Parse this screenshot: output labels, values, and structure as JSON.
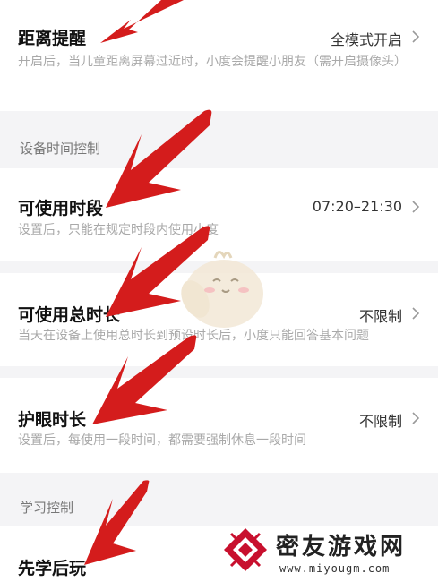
{
  "settings": {
    "distance_reminder": {
      "title": "距离提醒",
      "value": "全模式开启",
      "description": "开启后，当儿童距离屏幕过近时，小度会提醒小朋友（需开启摄像头）"
    },
    "device_time_section": "设备时间控制",
    "usable_period": {
      "title": "可使用时段",
      "value": "07:20–21:30",
      "description": "设置后，只能在规定时段内使用小度"
    },
    "usable_total": {
      "title": "可使用总时长",
      "value": "不限制",
      "description": "当天在设备上使用总时长到预设时长后，小度只能回答基本问题"
    },
    "eye_care": {
      "title": "护眼时长",
      "value": "不限制",
      "description": "设置后，每使用一段时间，都需要强制休息一段时间"
    },
    "study_section": "学习控制",
    "learn_first": {
      "title": "先学后玩"
    }
  },
  "watermark": {
    "title": "密友游戏网",
    "url": "www.miyougm.com"
  },
  "colors": {
    "arrow": "#d41c1c",
    "card": "#ffffff",
    "background": "#f4f4f6",
    "watermark_logo": "#c8102e"
  },
  "icons": {
    "chevron": "chevron-right-icon",
    "arrow": "red-arrow-annotation",
    "mascot": "mascot-illustration",
    "logo": "watermark-logo"
  }
}
